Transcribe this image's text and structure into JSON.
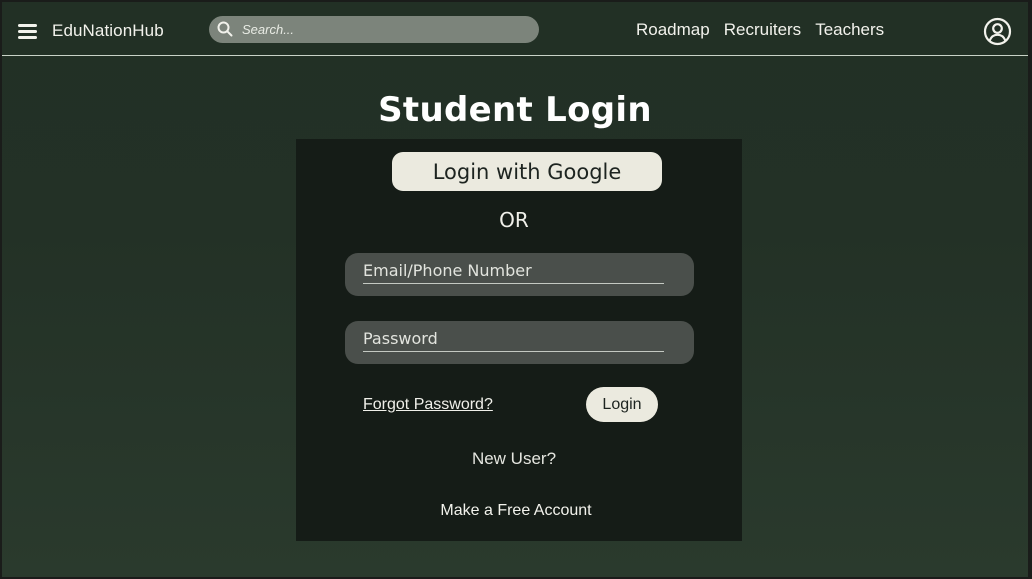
{
  "navbar": {
    "brand": "EduNationHub",
    "search_placeholder": "Search...",
    "links": [
      "Roadmap",
      "Recruiters",
      "Teachers"
    ]
  },
  "page": {
    "title": "Student Login"
  },
  "login_card": {
    "google_button": "Login with Google",
    "or_text": "OR",
    "email_placeholder": "Email/Phone Number",
    "password_placeholder": "Password",
    "forgot_password": "Forgot Password?",
    "login_button": "Login",
    "new_user_text": "New User?",
    "signup_link": "Make a Free Account"
  },
  "colors": {
    "background": "#233126",
    "card": "#151c17",
    "button": "#ebeadf",
    "field": "#4a4f4b",
    "search": "#7c847b"
  },
  "icons": {
    "menu": "hamburger-menu-icon",
    "search": "search-icon",
    "profile": "user-profile-icon"
  }
}
